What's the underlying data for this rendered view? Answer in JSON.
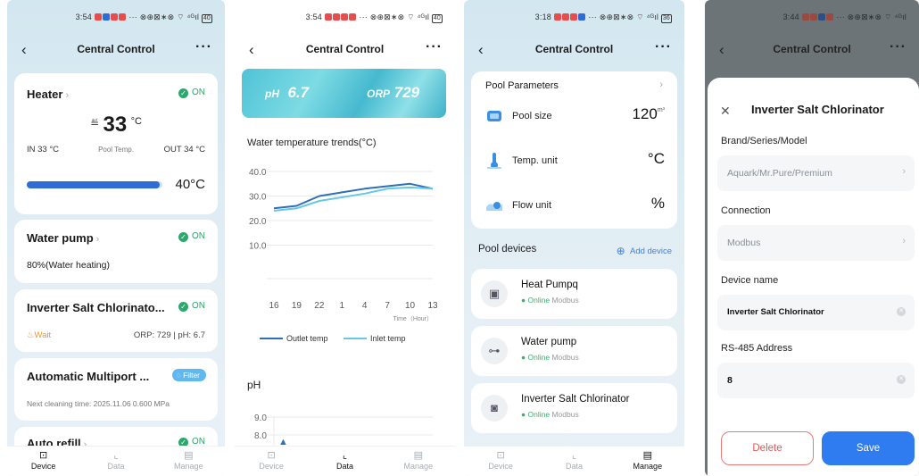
{
  "phone1": {
    "status_time": "3:54",
    "status_icons": "··· ⊗⊕⊠∗⊗ ⌔ ⁴ᴳıl",
    "battery": "40",
    "nav": {
      "back": "‹",
      "title": "Central Control",
      "more": "···"
    },
    "heater": {
      "title": "Heater",
      "chevron": "›",
      "status": "ON",
      "check": "✓",
      "icon": "heater-icon",
      "temp": "33",
      "temp_unit": "°C",
      "in_label": "IN",
      "in_value": "33 °C",
      "pool_temp_label": "Pool Temp.",
      "out_label": "OUT",
      "out_value": "34 °C",
      "setpoint": "40°C",
      "setpoint_fill": 0.98
    },
    "water_pump": {
      "title": "Water pump",
      "chevron": "›",
      "status": "ON",
      "check": "✓",
      "detail": "80%(Water heating)"
    },
    "chlorinator": {
      "title": "Inverter Salt Chlorinato...",
      "status": "ON",
      "check": "✓",
      "wait": "Wait",
      "readings": "ORP: 729 | pH: 6.7"
    },
    "multiport": {
      "title": "Automatic Multiport ...",
      "badge": "Filter",
      "detail": "Next cleaning time: 2025.11.06 0.600 MPa"
    },
    "auto_refill": {
      "title": "Auto refill",
      "chevron": "›",
      "status": "ON",
      "check": "✓"
    },
    "tabs": [
      {
        "label": "Device",
        "icon": "device-icon",
        "glyph": "⊡"
      },
      {
        "label": "Data",
        "icon": "chart-icon",
        "glyph": "⌞"
      },
      {
        "label": "Manage",
        "icon": "manage-icon",
        "glyph": "▤"
      }
    ]
  },
  "phone2": {
    "status_time": "3:54",
    "status_icons": "··· ⊗⊕⊠∗⊗ ⌔ ⁴ᴳıl",
    "battery": "40",
    "nav": {
      "back": "‹",
      "title": "Central Control",
      "more": "···"
    },
    "banner": {
      "ph_label": "pH",
      "ph_value": "6.7",
      "orp_label": "ORP",
      "orp_value": "729"
    },
    "temp_section_title": "Water temperature trends(°C)",
    "ph_section_title": "pH",
    "chart_data": [
      {
        "type": "line",
        "title": "Water temperature trends(°C)",
        "x_label": "Time（Hour）",
        "x": [
          16,
          19,
          22,
          1,
          4,
          7,
          10,
          13
        ],
        "x_tick_labels": [
          "16",
          "19",
          "22",
          "1",
          "4",
          "7",
          "10",
          "13"
        ],
        "ylim": [
          0,
          40
        ],
        "y_ticks": [
          "40.0",
          "30.0",
          "20.0",
          "10.0"
        ],
        "grid": true,
        "legend_position": "bottom",
        "series": [
          {
            "name": "Outlet temp",
            "color": "#2e6fb8",
            "values": [
              25,
              26,
              30,
              31.5,
              33,
              34,
              35,
              33
            ]
          },
          {
            "name": "Inlet temp",
            "color": "#66c7e6",
            "values": [
              24,
              25,
              28,
              29.5,
              31,
              33,
              33.5,
              33
            ]
          }
        ]
      },
      {
        "type": "line",
        "title": "pH",
        "ylim": [
          8,
          9
        ],
        "y_ticks": [
          "9.0",
          "8.0"
        ],
        "grid": true,
        "series": []
      }
    ],
    "tabs": [
      {
        "label": "Device",
        "icon": "device-icon",
        "glyph": "⊡"
      },
      {
        "label": "Data",
        "icon": "chart-icon",
        "glyph": "⌞"
      },
      {
        "label": "Manage",
        "icon": "manage-icon",
        "glyph": "▤"
      }
    ]
  },
  "phone3": {
    "status_time": "3:18",
    "status_icons": "··· ⊗⊕⊠∗⊗ ⌔ ⁴ᴳıl",
    "battery": "36",
    "nav": {
      "back": "‹",
      "title": "Central Control",
      "more": "···"
    },
    "pool_params": {
      "title": "Pool Parameters",
      "chevron": "›",
      "rows": [
        {
          "label": "Pool size",
          "value": "120",
          "unit": "m³",
          "icon": "pool-size-icon"
        },
        {
          "label": "Temp. unit",
          "value": "°C",
          "unit": "",
          "icon": "thermometer-icon"
        },
        {
          "label": "Flow unit",
          "value": "%",
          "unit": "",
          "icon": "flow-icon"
        }
      ]
    },
    "pool_devices_title": "Pool devices",
    "add_device": "Add device",
    "add_icon": "⊕",
    "devices": [
      {
        "name": "Heat Pumpq",
        "status": "Online",
        "protocol": "Modbus",
        "icon": "heat-pump-icon",
        "glyph": "▣"
      },
      {
        "name": "Water pump",
        "status": "Online",
        "protocol": "Modbus",
        "icon": "water-pump-icon",
        "glyph": "⊶"
      },
      {
        "name": "Inverter Salt Chlorinator",
        "status": "Online",
        "protocol": "Modbus",
        "icon": "chlorinator-icon",
        "glyph": "◙"
      }
    ],
    "tabs": [
      {
        "label": "Device",
        "icon": "device-icon",
        "glyph": "⊡"
      },
      {
        "label": "Data",
        "icon": "chart-icon",
        "glyph": "⌞"
      },
      {
        "label": "Manage",
        "icon": "manage-icon",
        "glyph": "▤"
      }
    ]
  },
  "phone4": {
    "status_time": "3:44",
    "status_icons": "··· ⊗⊕⊠∗⊗ ⌔ ⁴ᴳıl",
    "nav": {
      "back": "‹",
      "title": "Central Control",
      "more": "···"
    },
    "sheet": {
      "close": "✕",
      "title": "Inverter Salt Chlorinator",
      "brand_label": "Brand/Series/Model",
      "brand_value": "Aquark/Mr.Pure/Premium",
      "connection_label": "Connection",
      "connection_value": "Modbus",
      "device_name_label": "Device name",
      "device_name_value": "Inverter Salt Chlorinator",
      "address_label": "RS-485 Address",
      "address_value": "8",
      "chevron": "›",
      "clear": "✕",
      "delete_label": "Delete",
      "save_label": "Save"
    }
  }
}
